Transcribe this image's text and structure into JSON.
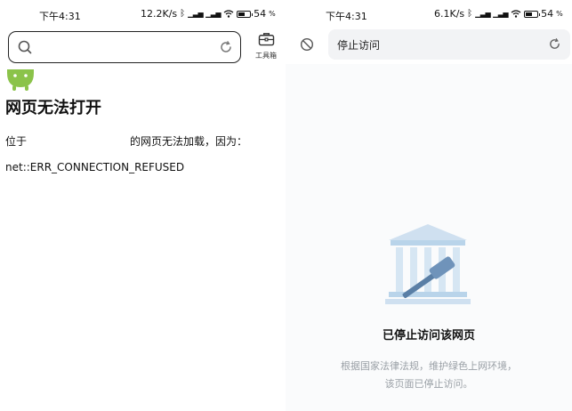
{
  "left": {
    "status": {
      "time": "下午4:31",
      "speed": "12.2K/s",
      "battery": "54",
      "battery_level": 0.54
    },
    "toolbox_label": "工具箱",
    "error": {
      "title": "网页无法打开",
      "desc_prefix": "位于",
      "desc_suffix": "的网页无法加载，因为：",
      "code": "net::ERR_CONNECTION_REFUSED"
    },
    "colors": {
      "android_green": "#8bc34a"
    }
  },
  "right": {
    "status": {
      "time": "下午4:31",
      "speed": "6.1K/s",
      "battery": "54",
      "battery_level": 0.54
    },
    "address_text": "停止访问",
    "blocked": {
      "title": "已停止访问该网页",
      "line1": "根据国家法律法规，维护绿色上网环境，",
      "line2": "该页面已停止访问。"
    },
    "colors": {
      "illustration_blue": "#b9d4ea",
      "illustration_dark": "#5a7fa6"
    }
  }
}
